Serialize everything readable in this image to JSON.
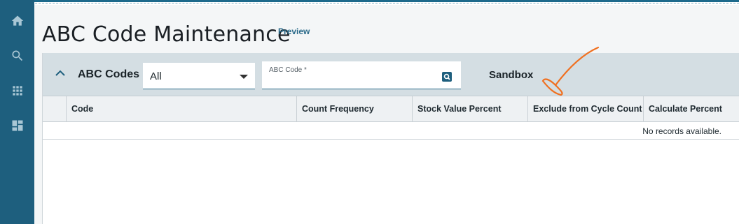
{
  "sidebar": {
    "items": [
      {
        "icon": "home-icon",
        "label": "Home"
      },
      {
        "icon": "search-icon",
        "label": "Search"
      },
      {
        "icon": "apps-grid-icon",
        "label": "Apps"
      },
      {
        "icon": "dashboard-icon",
        "label": "Dashboard"
      }
    ],
    "color": "#1e5f7e"
  },
  "page": {
    "title": "ABC Code Maintenance",
    "preview_label": "Preview"
  },
  "toolbar": {
    "section_title": "ABC Codes",
    "filter_value": "All",
    "code_field_label": "ABC Code *",
    "code_field_value": "",
    "environment_label": "Sandbox"
  },
  "grid": {
    "columns": [
      "Code",
      "Count Frequency",
      "Stock Value Percent",
      "Exclude from Cycle Count",
      "Calculate Percent"
    ],
    "empty_message": "No records available."
  },
  "colors": {
    "accent": "#2a6a8a",
    "annotation": "#f07020"
  }
}
